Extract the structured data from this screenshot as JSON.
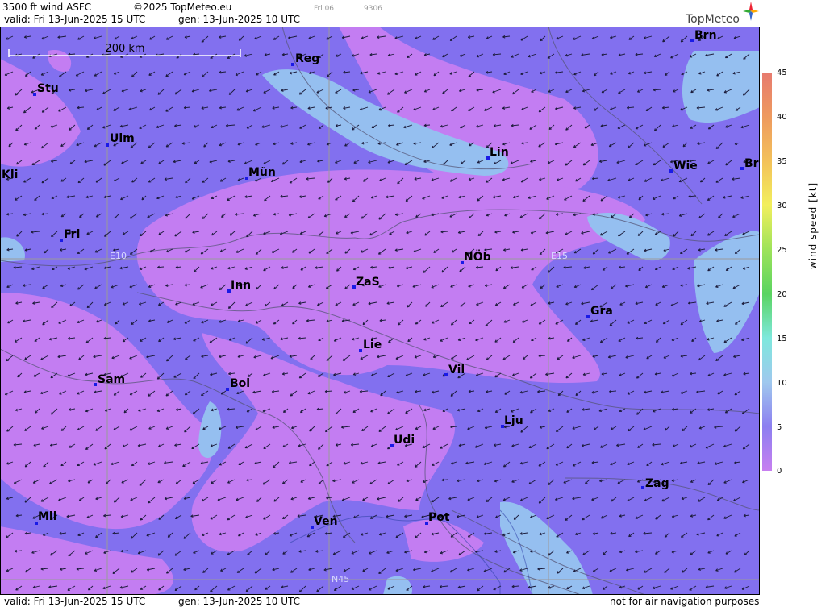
{
  "header": {
    "product": "3500 ft wind ASFC",
    "copyright": "©2025 TopMeteo.eu",
    "valid": "valid:  Fri  13-Jun-2025  15 UTC",
    "gen": "gen: 13-Jun-2025 10 UTC",
    "tiny_day": "Fri 06",
    "tiny_code": "9306",
    "logo": "TopMeteo"
  },
  "footer": {
    "valid": "valid:  Fri  13-Jun-2025  15 UTC",
    "gen": "gen: 13-Jun-2025 10 UTC",
    "disclaimer": "not for air navigation purposes"
  },
  "map": {
    "scale_label": "200 km",
    "grid_labels": [
      "E10",
      "E15",
      "N45"
    ],
    "cities": [
      "Stu",
      "Reg",
      "Brn",
      "Ulm",
      "Lin",
      "Kli",
      "Mün",
      "Wie",
      "Br",
      "Fri",
      "NÖb",
      "Inn",
      "ZaS",
      "Gra",
      "Lie",
      "Vil",
      "Sam",
      "Bol",
      "Lju",
      "Udi",
      "Zag",
      "Mil",
      "Ven",
      "Pot"
    ]
  },
  "legend": {
    "title": "wind  speed  [kt]",
    "ticks": [
      "45",
      "40",
      "35",
      "30",
      "25",
      "20",
      "15",
      "10",
      "5",
      "0"
    ],
    "colors": [
      "#e77b6f",
      "#ee9a5f",
      "#f3c15a",
      "#f2ef5c",
      "#9ee35a",
      "#5ad461",
      "#7ee8dd",
      "#9fc8ee",
      "#8c7ff0",
      "#c77ff0"
    ]
  }
}
